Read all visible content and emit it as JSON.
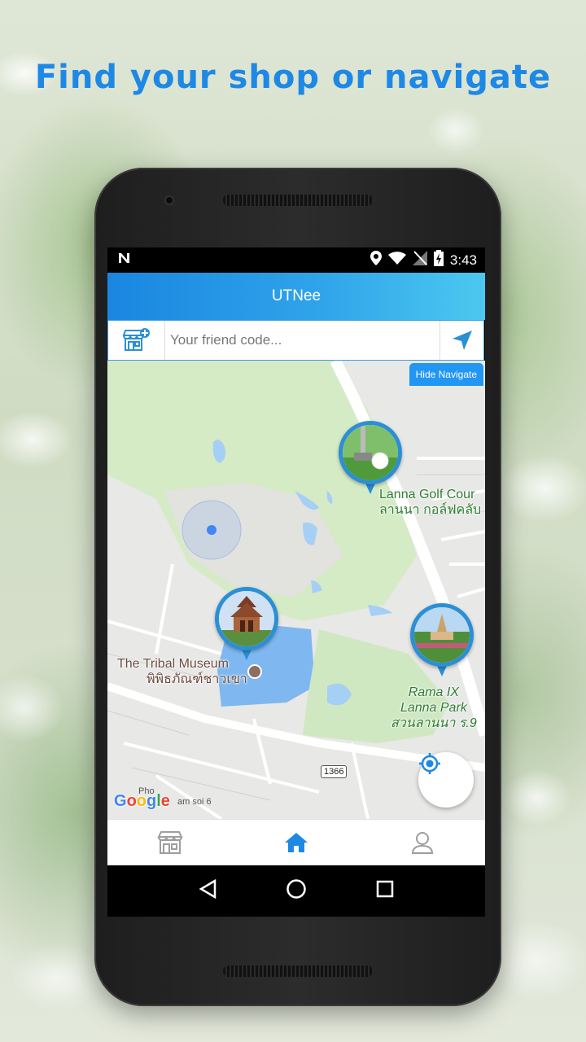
{
  "headline": "Find your shop or navigate",
  "status_bar": {
    "time": "3:43",
    "icons": [
      "n-notification-icon",
      "location-icon",
      "wifi-icon",
      "no-signal-icon",
      "battery-charging-icon"
    ]
  },
  "app": {
    "title": "UTNee",
    "search": {
      "placeholder": "Your friend code...",
      "value": ""
    },
    "hide_navigate_label": "Hide Navigate"
  },
  "map": {
    "places": [
      {
        "name": "Lanna Golf Cour",
        "name_thai": "ลานนา กอล์ฟคลับ"
      },
      {
        "name": "The Tribal Museum",
        "name_thai": "พิพิธภัณฑ์ชาวเขา"
      },
      {
        "name_line1": "Rama IX",
        "name_line2": "Lanna Park",
        "name_thai": "สวนลานนา ร.9"
      }
    ],
    "route_number": "1366",
    "street_label_1": "Pho",
    "street_label_2": "am soi 6",
    "attribution": "Google"
  },
  "bottom_nav": [
    "shop-icon",
    "home-icon",
    "profile-icon"
  ],
  "colors": {
    "accent": "#1e88e5",
    "appbar_start": "#1a86e0",
    "appbar_end": "#4cc8ef",
    "park_green": "#cfe8c2",
    "water": "#a6cff5"
  }
}
